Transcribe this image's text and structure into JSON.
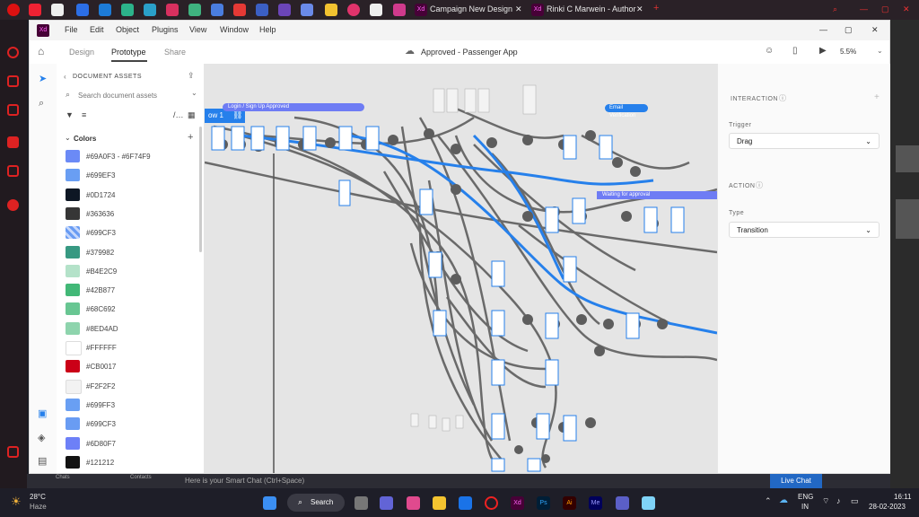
{
  "browser_tabs": {
    "tab1": "Campaign New Design",
    "tab2": "Rinki C Marwein - Author"
  },
  "app": {
    "logo": "Xd",
    "menu": [
      "File",
      "Edit",
      "Object",
      "Plugins",
      "View",
      "Window",
      "Help"
    ],
    "modes": {
      "design": "Design",
      "prototype": "Prototype",
      "share": "Share"
    },
    "doc_title": "Approved - Passenger App",
    "zoom": "5.5%",
    "accent": "#2680eb"
  },
  "assets": {
    "header": "DOCUMENT ASSETS",
    "search_placeholder": "Search document assets",
    "colors_label": "Colors",
    "colors": [
      {
        "label": "#69A0F3 - #6F74F9",
        "hex": "#6b8af6"
      },
      {
        "label": "#699EF3",
        "hex": "#699ef3"
      },
      {
        "label": "#0D1724",
        "hex": "#0d1724"
      },
      {
        "label": "#363636",
        "hex": "#363636"
      },
      {
        "label": "#699CF3",
        "hex": "#699cf3"
      },
      {
        "label": "#379982",
        "hex": "#379982"
      },
      {
        "label": "#B4E2C9",
        "hex": "#b4e2c9"
      },
      {
        "label": "#42B877",
        "hex": "#42b877"
      },
      {
        "label": "#68C692",
        "hex": "#68c692"
      },
      {
        "label": "#8ED4AD",
        "hex": "#8ed4ad"
      },
      {
        "label": "#FFFFFF",
        "hex": "#ffffff"
      },
      {
        "label": "#CB0017",
        "hex": "#cb0017"
      },
      {
        "label": "#F2F2F2",
        "hex": "#f2f2f2"
      },
      {
        "label": "#699FF3",
        "hex": "#699ff3"
      },
      {
        "label": "#699CF3",
        "hex": "#699cf3"
      },
      {
        "label": "#6D80F7",
        "hex": "#6d80f7"
      },
      {
        "label": "#121212",
        "hex": "#121212"
      }
    ]
  },
  "canvas": {
    "flow_label": "ow 1",
    "banner_signup": "Login / Sign Up Approved",
    "banner_email": "Email Verification",
    "banner_waiting": "Waiting for approval"
  },
  "interaction": {
    "header": "INTERACTION",
    "trigger_label": "Trigger",
    "trigger_value": "Drag",
    "action_header": "ACTION",
    "type_label": "Type",
    "type_value": "Transition"
  },
  "taskbar": {
    "weather_temp": "28°C",
    "weather_desc": "Haze",
    "search": "Search",
    "smart_chat": "Here is your Smart Chat (Ctrl+Space)",
    "chats": "Chats",
    "contacts": "Contacts",
    "live_chat": "Live Chat",
    "lang": "ENG",
    "region": "IN",
    "time": "16:11",
    "date": "28-02-2023"
  }
}
